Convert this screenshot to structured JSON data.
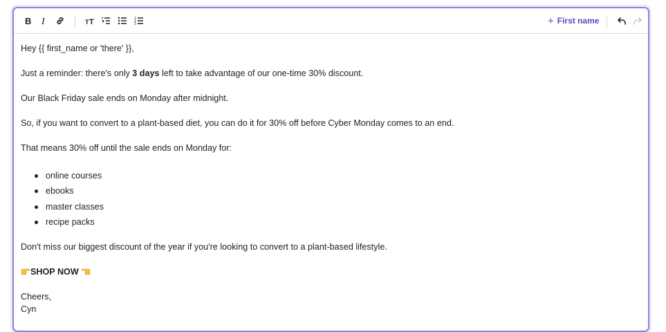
{
  "toolbar": {
    "insert_first_name_label": "First name"
  },
  "email": {
    "greeting": "Hey {{ first_name or 'there' }},",
    "reminder_before": "Just a reminder: there's only ",
    "reminder_bold": "3 days",
    "reminder_after": " left to take advantage of our one-time 30% discount.",
    "sale_end": "Our Black Friday sale ends on Monday after midnight.",
    "convert": "So, if you want to convert to a plant-based diet, you can do it for 30% off before Cyber Monday comes to an end.",
    "means": "That means 30% off until the sale ends on Monday for:",
    "items": [
      "online courses",
      "ebooks",
      "master classes",
      "recipe packs"
    ],
    "dont_miss": "Don't miss our biggest discount of the year if you're looking to convert to a plant-based lifestyle.",
    "cta": "SHOP NOW",
    "signoff": "Cheers,",
    "name": "Cyn"
  },
  "colors": {
    "accent": "#5a4bc4",
    "border_focus": "#8c7fe0"
  }
}
